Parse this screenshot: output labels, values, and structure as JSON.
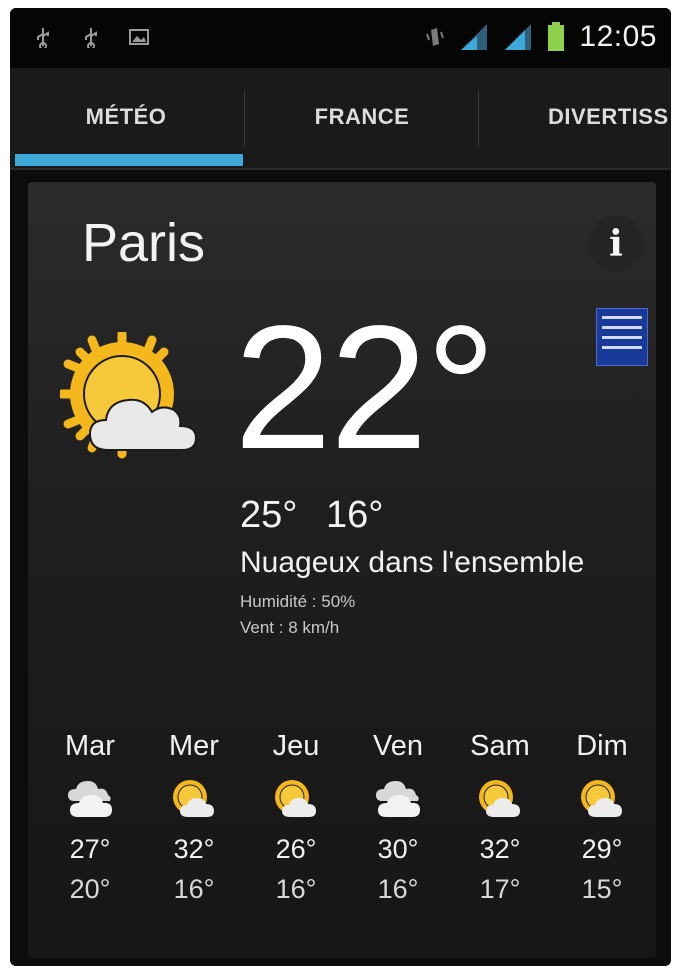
{
  "status_bar": {
    "time": "12:05",
    "icons": [
      "usb-icon",
      "usb-icon",
      "image-notification-icon",
      "vibrate-icon",
      "signal-icon",
      "signal-icon",
      "battery-icon"
    ]
  },
  "tabs": [
    {
      "label": "MÉTÉO",
      "selected": true
    },
    {
      "label": "FRANCE",
      "selected": false
    },
    {
      "label": "DIVERTISS",
      "selected": false
    }
  ],
  "accent_color": "#3ea9d8",
  "weather": {
    "city": "Paris",
    "current_temp": "22°",
    "high": "25°",
    "low": "16°",
    "condition": "Nuageux dans l'ensemble",
    "humidity": "Humidité : 50%",
    "wind": "Vent : 8 km/h",
    "icon": "partly-cloudy-icon"
  },
  "forecast": [
    {
      "day": "Mar",
      "hi": "27°",
      "lo": "20°",
      "icon": "cloudy-icon"
    },
    {
      "day": "Mer",
      "hi": "32°",
      "lo": "16°",
      "icon": "partly-cloudy-icon"
    },
    {
      "day": "Jeu",
      "hi": "26°",
      "lo": "16°",
      "icon": "partly-cloudy-icon"
    },
    {
      "day": "Ven",
      "hi": "30°",
      "lo": "16°",
      "icon": "cloudy-icon"
    },
    {
      "day": "Sam",
      "hi": "32°",
      "lo": "17°",
      "icon": "partly-cloudy-icon"
    },
    {
      "day": "Dim",
      "hi": "29°",
      "lo": "15°",
      "icon": "partly-cloudy-icon"
    }
  ]
}
